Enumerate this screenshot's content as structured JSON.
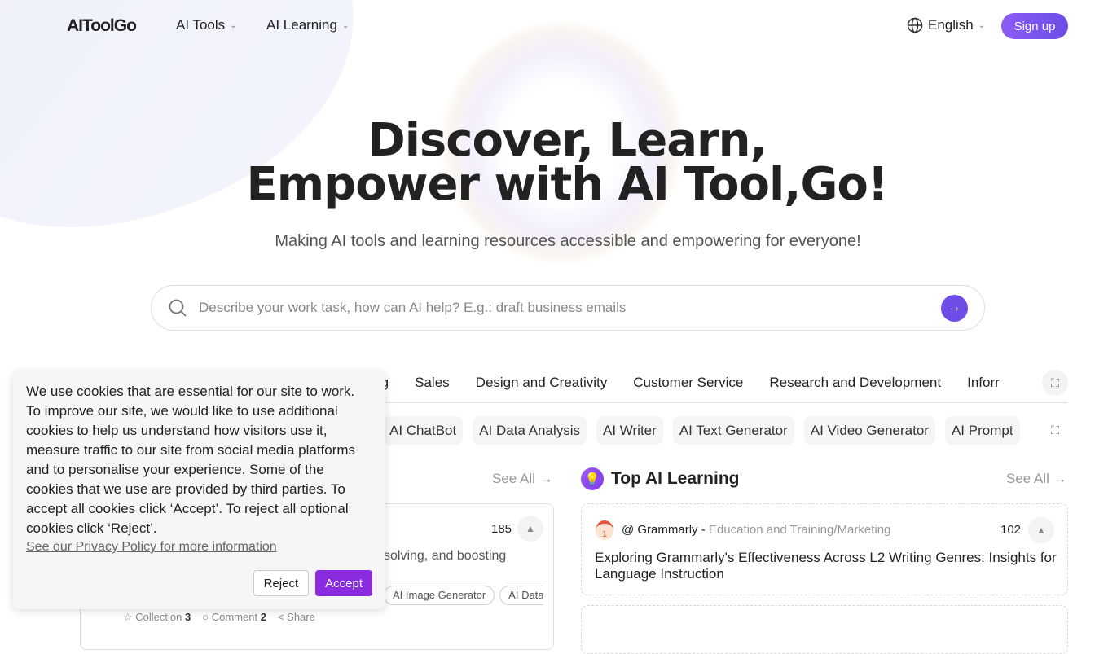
{
  "header": {
    "logo": "AIToolGo",
    "nav": [
      {
        "label": "AI Tools"
      },
      {
        "label": "AI Learning"
      }
    ],
    "language": "English",
    "signup": "Sign up"
  },
  "hero": {
    "title_line1": "Discover, Learn,",
    "title_line2": "Empower with AI Tool,Go!",
    "subtitle": "Making AI tools and learning resources accessible and empowering for everyone!"
  },
  "search": {
    "placeholder": "Describe your work task, how can AI help? E.g.: draft business emails"
  },
  "categories": [
    "ning",
    "Sales",
    "Design and Creativity",
    "Customer Service",
    "Research and Development",
    "Inforr"
  ],
  "chips": [
    "AI ChatBot",
    "AI Data Analysis",
    "AI Writer",
    "AI Text Generator",
    "AI Video Generator",
    "AI Prompt"
  ],
  "left_section": {
    "see_all": "See All →",
    "card": {
      "votes": "185",
      "desc": "solving, and boosting",
      "tags": [
        "AI Image Generator",
        "AI Data"
      ],
      "collection_label": "Collection",
      "collection_count": "3",
      "comment_label": "Comment",
      "comment_count": "2",
      "share_label": "Share"
    }
  },
  "right_section": {
    "title": "Top AI Learning",
    "see_all": "See All →",
    "card": {
      "author": "@ Grammarly",
      "separator": "-",
      "category": "Education and Training/Marketing",
      "votes": "102",
      "title": "Exploring Grammarly's Effectiveness Across L2 Writing Genres: Insights for Language Instruction"
    }
  },
  "cookie": {
    "text": "We use cookies that are essential for our site to work. To improve our site, we would like to use additional cookies to help us understand how visitors use it, measure traffic to our site from social media platforms and to personalise your experience. Some of the cookies that we use are provided by third parties. To accept all cookies click ‘Accept’. To reject all optional cookies click ‘Reject’.",
    "link": "See our Privacy Policy for more information",
    "reject": "Reject",
    "accept": "Accept"
  },
  "colors": {
    "accent": "#6d4de6",
    "accept": "#8a2be2"
  }
}
